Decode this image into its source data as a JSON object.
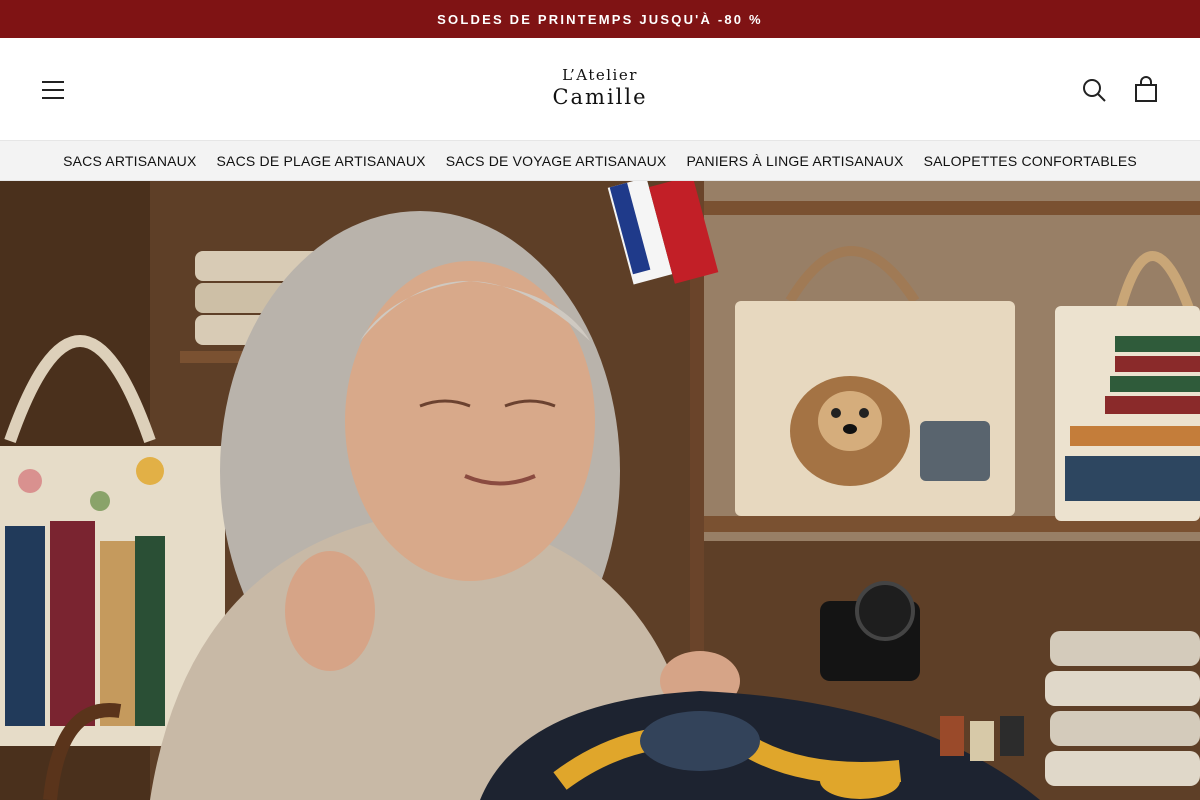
{
  "announcement": {
    "text": "SOLDES DE PRINTEMPS JUSQU'À -80 %"
  },
  "header": {
    "logo_line1": "L’Atelier",
    "logo_line2": "Camille",
    "menu_icon": "hamburger-menu-icon",
    "search_icon": "search-icon",
    "cart_icon": "shopping-bag-icon"
  },
  "nav": {
    "items": [
      {
        "label": "SACS ARTISANAUX"
      },
      {
        "label": "SACS DE PLAGE ARTISANAUX"
      },
      {
        "label": "SACS DE VOYAGE ARTISANAUX"
      },
      {
        "label": "PANIERS À LINGE ARTISANAUX"
      },
      {
        "label": "SALOPETTES CONFORTABLES"
      }
    ]
  },
  "hero": {
    "image_subject": "elderly woman sewing quilted bag in workshop"
  },
  "colors": {
    "announcement_bg": "#7f1314",
    "nav_bg": "#f3f3f3",
    "text": "#111111"
  }
}
